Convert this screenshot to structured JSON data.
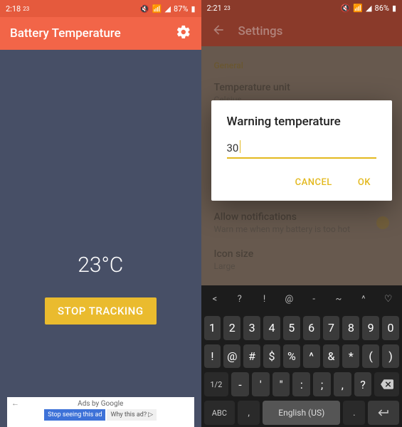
{
  "left": {
    "status": {
      "time": "2:18",
      "time_sub": "23",
      "battery": "87%"
    },
    "app_title": "Battery Temperature",
    "temperature": "23°C",
    "stop_button": "STOP TRACKING",
    "ad": {
      "title": "Ads by Google",
      "btn1": "Stop seeing this ad",
      "btn2": "Why this ad? ▷"
    }
  },
  "right": {
    "status": {
      "time": "2:21",
      "time_sub": "23",
      "battery": "86%"
    },
    "app_title": "Settings",
    "section_general": "General",
    "items": {
      "temp_unit": {
        "title": "Temperature unit",
        "sub": "Celsius"
      },
      "allow_notif": {
        "title": "Allow notifications",
        "sub": "Warn me when my battery is too hot"
      },
      "icon_size": {
        "title": "Icon size",
        "sub": "Large"
      }
    },
    "dialog": {
      "title": "Warning temperature",
      "value": "30",
      "cancel": "CANCEL",
      "ok": "OK"
    },
    "keyboard": {
      "sym_row": [
        "<",
        "?",
        "!",
        "@",
        "-",
        "~",
        "^",
        "♡"
      ],
      "row1": [
        "1",
        "2",
        "3",
        "4",
        "5",
        "6",
        "7",
        "8",
        "9",
        "0"
      ],
      "row2": [
        "!",
        "@",
        "#",
        "$",
        "%",
        "^",
        "&",
        "*",
        "(",
        ")"
      ],
      "row3_left": "1/2",
      "row3": [
        "-",
        "'",
        "\"",
        ":",
        ";",
        ",",
        "?"
      ],
      "row4_abc": "ABC",
      "row4_comma": ",",
      "space": "English (US)",
      "row4_dot": "."
    }
  }
}
